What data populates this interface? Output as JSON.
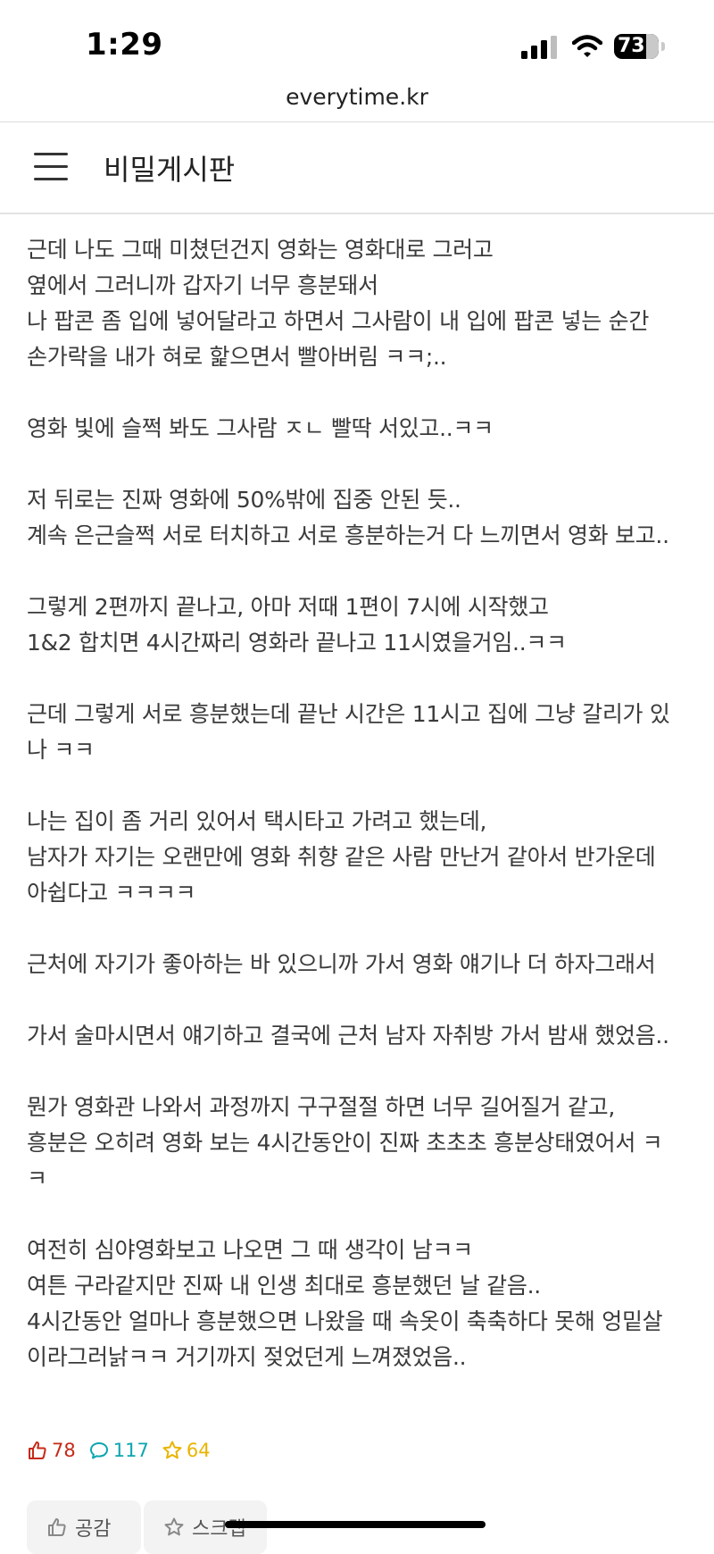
{
  "status_bar": {
    "time": "1:29",
    "battery": "73"
  },
  "browser": {
    "url": "everytime.kr"
  },
  "header": {
    "title": "비밀게시판",
    "menu_icon": "hamburger-menu-icon"
  },
  "post": {
    "paragraphs": [
      [
        "근데 나도 그때 미쳤던건지 영화는 영화대로 그러고",
        "옆에서 그러니까 갑자기 너무 흥분돼서",
        "나 팝콘 좀 입에 넣어달라고 하면서 그사람이 내 입에 팝콘 넣는 순간",
        "손가락을 내가 혀로 핥으면서 빨아버림 ㅋㅋ;.."
      ],
      [
        "영화 빛에 슬쩍 봐도 그사람 ㅈㄴ 빨딱 서있고..ㅋㅋ"
      ],
      [
        "저 뒤로는 진짜 영화에 50%밖에 집중 안된 듯..",
        "계속 은근슬쩍 서로 터치하고 서로 흥분하는거 다 느끼면서 영화 보고.."
      ],
      [
        "그렇게 2편까지 끝나고, 아마 저때 1편이 7시에 시작했고",
        "1&2 합치면 4시간짜리 영화라 끝나고 11시였을거임..ㅋㅋ"
      ],
      [
        "근데 그렇게 서로 흥분했는데 끝난 시간은 11시고 집에 그냥 갈리가 있",
        "나 ㅋㅋ"
      ],
      [
        "나는 집이 좀 거리 있어서 택시타고 가려고 했는데,",
        "남자가 자기는 오랜만에 영화 취향 같은 사람 만난거 같아서 반가운데",
        "아쉽다고 ㅋㅋㅋㅋ"
      ],
      [
        "근처에 자기가 좋아하는 바 있으니까 가서 영화 얘기나 더 하자그래서"
      ],
      [
        "가서 술마시면서 얘기하고 결국에 근처 남자 자취방 가서 밤새 했었음.."
      ],
      [
        "뭔가 영화관 나와서 과정까지 구구절절 하면 너무 길어질거 같고,",
        "흥분은 오히려 영화 보는 4시간동안이 진짜 초초초 흥분상태였어서 ㅋ",
        "ㅋ"
      ],
      [
        "여전히 심야영화보고 나오면 그 때 생각이 남ㅋㅋ",
        "여튼 구라같지만 진짜 내 인생 최대로 흥분했던 날 같음..",
        "4시간동안 얼마나 흥분했으면 나왔을 때 속옷이 축축하다 못해 엉밑살",
        "이라그러낡ㅋㅋ 거기까지 젖었던게 느껴졌었음.."
      ]
    ]
  },
  "reactions": {
    "likes": "78",
    "comments": "117",
    "scraps": "64",
    "colors": {
      "like": "#c62917",
      "comment": "#0ca5b0",
      "scrap": "#e9b400"
    }
  },
  "actions": {
    "like_label": "공감",
    "scrap_label": "스크랩"
  }
}
